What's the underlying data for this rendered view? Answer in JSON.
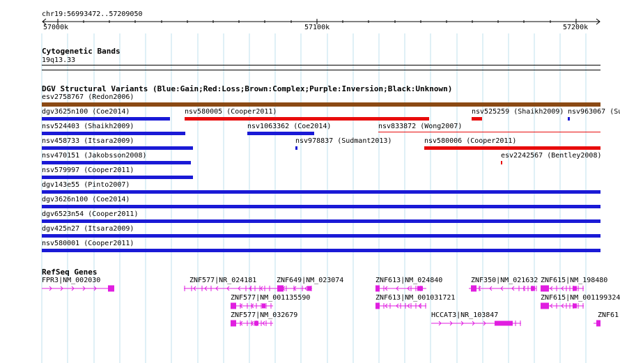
{
  "coords": {
    "label": "chr19:56993472..57209050",
    "ticks": [
      "57000k",
      "57100k",
      "57200k"
    ]
  },
  "cytobands": {
    "title": "Cytogenetic Bands",
    "band": "19q13.33"
  },
  "dgv": {
    "title": "DGV Structural Variants (Blue:Gain;Red:Loss;Brown:Complex;Purple:Inversion;Black:Unknown)",
    "colors": {
      "gain": "#1a1ad6",
      "loss": "#e80c0c",
      "complex": "#8b4a14"
    },
    "variants": [
      {
        "label": "esv2758767 (Redon2006)",
        "type": "complex"
      },
      {
        "label": "dgv3625n100 (Coe2014)",
        "type": "gain"
      },
      {
        "label": "nsv580005 (Cooper2011)",
        "type": "loss"
      },
      {
        "label": "nsv525259 (Shaikh2009)",
        "type": "loss"
      },
      {
        "label": "nsv963067 (Su",
        "type": "gain"
      },
      {
        "label": "nsv524403 (Shaikh2009)",
        "type": "gain"
      },
      {
        "label": "nsv1063362 (Coe2014)",
        "type": "gain"
      },
      {
        "label": "nsv833872 (Wong2007)",
        "type": "loss"
      },
      {
        "label": "nsv458733 (Itsara2009)",
        "type": "gain"
      },
      {
        "label": "nsv978837 (Sudmant2013)",
        "type": "gain"
      },
      {
        "label": "nsv580006 (Cooper2011)",
        "type": "loss"
      },
      {
        "label": "nsv470151 (Jakobsson2008)",
        "type": "gain"
      },
      {
        "label": "esv2242567 (Bentley2008)",
        "type": "loss"
      },
      {
        "label": "nsv579997 (Cooper2011)",
        "type": "gain"
      },
      {
        "label": "dgv143e55 (Pinto2007)",
        "type": "gain"
      },
      {
        "label": "dgv3626n100 (Coe2014)",
        "type": "gain"
      },
      {
        "label": "dgv6523n54 (Cooper2011)",
        "type": "gain"
      },
      {
        "label": "dgv425n27 (Itsara2009)",
        "type": "gain"
      },
      {
        "label": "nsv580001 (Cooper2011)",
        "type": "gain"
      }
    ]
  },
  "refseq": {
    "title": "RefSeq Genes",
    "color": "#e01ee0",
    "genes": [
      {
        "label": "FPR3|NM_002030"
      },
      {
        "label": "ZNF577|NR_024181"
      },
      {
        "label": "ZNF649|NM_023074"
      },
      {
        "label": "ZNF613|NM_024840"
      },
      {
        "label": "ZNF350|NM_021632"
      },
      {
        "label": "ZNF615|NM_198480"
      },
      {
        "label": "ZNF577|NM_001135590"
      },
      {
        "label": "ZNF613|NM_001031721"
      },
      {
        "label": "ZNF615|NM_001199324"
      },
      {
        "label": "ZNF577|NM_032679"
      },
      {
        "label": "HCCAT3|NR_103847"
      },
      {
        "label": "ZNF61"
      }
    ]
  }
}
